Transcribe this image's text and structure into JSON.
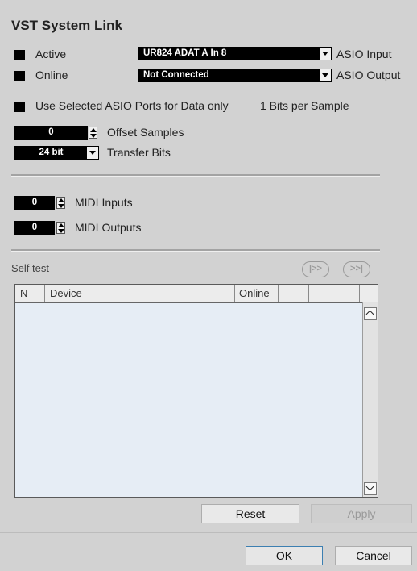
{
  "section_title": "VST System Link",
  "active": {
    "label": "Active",
    "checked": true
  },
  "online": {
    "label": "Online",
    "checked": true
  },
  "asio_input": {
    "value": "UR824 ADAT A In 8",
    "label": "ASIO Input"
  },
  "asio_output": {
    "value": "Not Connected",
    "label": "ASIO Output"
  },
  "use_selected_ports": {
    "label": "Use Selected ASIO Ports for Data only",
    "checked": true
  },
  "bits_per_sample": "1 Bits per Sample",
  "offset_samples": {
    "value": "0",
    "label": "Offset Samples"
  },
  "transfer_bits": {
    "value": "24 bit",
    "label": "Transfer Bits"
  },
  "midi_inputs": {
    "value": "0",
    "label": "MIDI Inputs"
  },
  "midi_outputs": {
    "value": "0",
    "label": "MIDI Outputs"
  },
  "self_test": "Self test",
  "transport_icons": [
    "play-forward-icon",
    "skip-forward-icon"
  ],
  "table": {
    "columns": [
      "N",
      "Device",
      "Online",
      "",
      ""
    ],
    "rows": []
  },
  "buttons": {
    "reset": "Reset",
    "apply": "Apply",
    "ok": "OK",
    "cancel": "Cancel"
  },
  "colors": {
    "background": "#d2d2d2",
    "field": "#000000",
    "table_bg": "#e6edf5",
    "focus_border": "#3c7fb1"
  }
}
